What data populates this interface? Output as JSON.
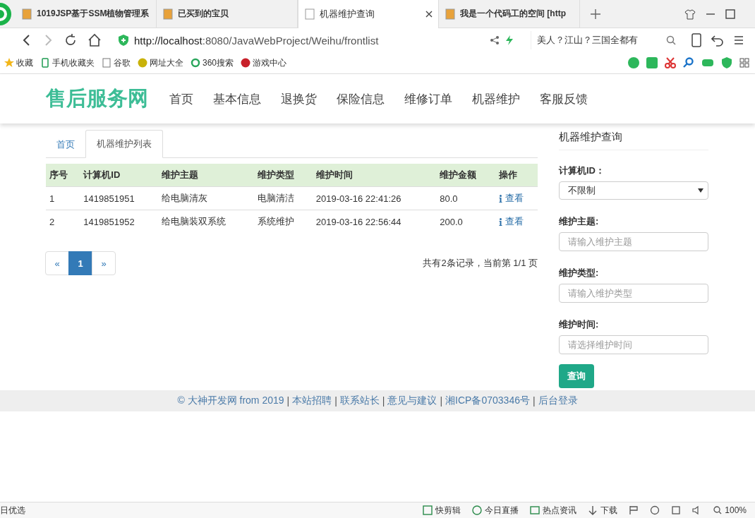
{
  "browser": {
    "tabs": [
      {
        "title": "1019JSP基于SSM植物管理系",
        "selected": false
      },
      {
        "title": "已买到的宝贝",
        "selected": false
      },
      {
        "title": "机器维护查询",
        "selected": true
      },
      {
        "title": "我是一个代码工的空间 [http",
        "selected": false
      }
    ],
    "url_host": "http://localhost",
    "url_rest": ":8080/JavaWebProject/Weihu/frontlist",
    "search_hint": "美人？江山？三国全都有",
    "bookmarks": [
      {
        "label": "收藏"
      },
      {
        "label": "手机收藏夹"
      },
      {
        "label": "谷歌"
      },
      {
        "label": "网址大全"
      },
      {
        "label": "360搜索"
      },
      {
        "label": "游戏中心"
      }
    ]
  },
  "site": {
    "logo": "售后服务网",
    "nav": [
      {
        "label": "首页"
      },
      {
        "label": "基本信息"
      },
      {
        "label": "退换货"
      },
      {
        "label": "保险信息"
      },
      {
        "label": "维修订单"
      },
      {
        "label": "机器维护"
      },
      {
        "label": "客服反馈"
      }
    ]
  },
  "breadcrumb_tabs": [
    {
      "label": "首页",
      "selected": false
    },
    {
      "label": "机器维护列表",
      "selected": true
    }
  ],
  "table": {
    "columns": [
      "序号",
      "计算机ID",
      "维护主题",
      "维护类型",
      "维护时间",
      "维护金额",
      "操作"
    ],
    "rows": [
      [
        "1",
        "1419851951",
        "给电脑清灰",
        "电脑清洁",
        "2019-03-16 22:41:26",
        "80.0",
        "查看"
      ],
      [
        "2",
        "1419851952",
        "给电脑装双系统",
        "系统维护",
        "2019-03-16 22:56:44",
        "200.0",
        "查看"
      ]
    ]
  },
  "pagination": [
    {
      "label": "«",
      "selected": false
    },
    {
      "label": "1",
      "selected": true
    },
    {
      "label": "»",
      "selected": false
    }
  ],
  "page_info": "共有2条记录，当前第 1/1 页",
  "search_panel": {
    "title": "机器维护查询",
    "computer_label": "计算机ID：",
    "computer_value": "不限制",
    "topic_label": "维护主题:",
    "topic_placeholder": "请输入维护主题",
    "type_label": "维护类型:",
    "type_placeholder": "请输入维护类型",
    "time_label": "维护时间:",
    "time_placeholder": "请选择维护时间",
    "button": "查询"
  },
  "footer": {
    "copyright": "© 大神开发网 from 2019",
    "separator": "|",
    "links": [
      "本站招聘",
      "联系站长",
      "意见与建议",
      "湘ICP备0703346号",
      "后台登录"
    ]
  },
  "status_bar": {
    "left": "日优选",
    "items": [
      "快剪辑",
      "今日直播",
      "热点资讯",
      "下载"
    ],
    "zoom": "100%"
  }
}
